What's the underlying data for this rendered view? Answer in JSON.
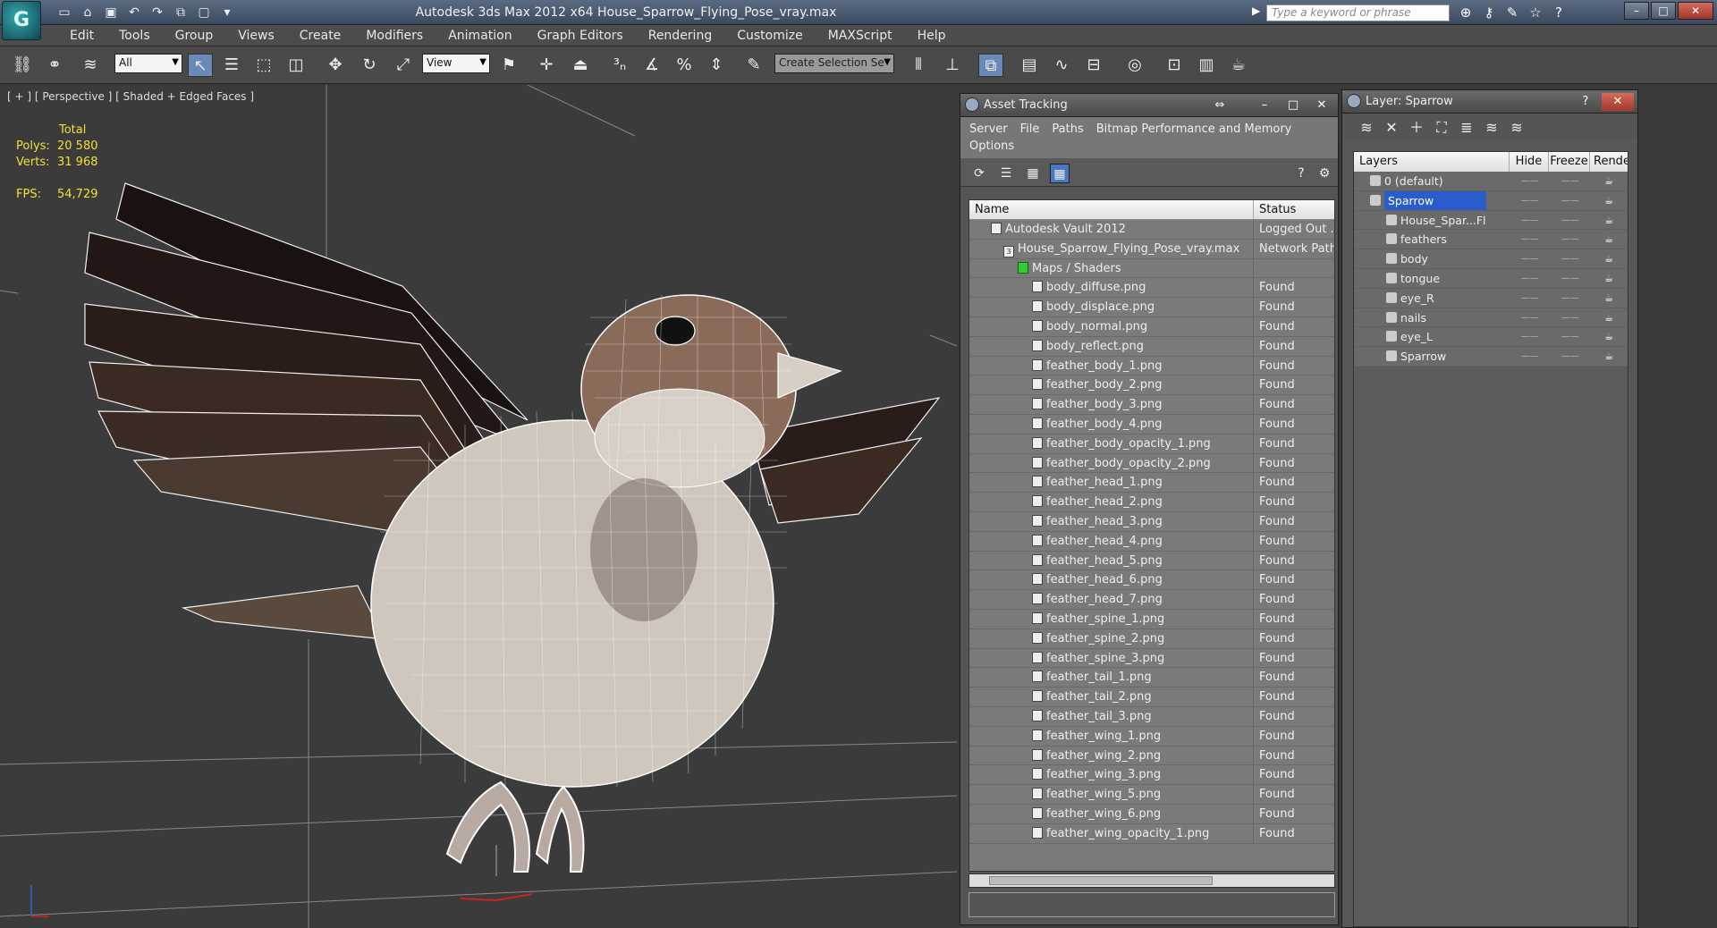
{
  "app": {
    "logo": "G",
    "title": "Autodesk 3ds Max  2012 x64       House_Sparrow_Flying_Pose_vray.max",
    "search_placeholder": "Type a keyword or phrase"
  },
  "menu": [
    "Edit",
    "Tools",
    "Group",
    "Views",
    "Create",
    "Modifiers",
    "Animation",
    "Graph Editors",
    "Rendering",
    "Customize",
    "MAXScript",
    "Help"
  ],
  "toolbar": {
    "selection_filter": "All",
    "ref_coord": "View",
    "named_selection": "Create Selection Se"
  },
  "viewport": {
    "label": "[ + ] [ Perspective ] [ Shaded + Edged Faces ]",
    "stats_header": "Total",
    "polys_label": "Polys:",
    "polys_value": "20 580",
    "verts_label": "Verts:",
    "verts_value": "31 968",
    "fps_label": "FPS:",
    "fps_value": "54,729"
  },
  "asset_tracking": {
    "title": "Asset Tracking",
    "menu": [
      "Server",
      "File",
      "Paths",
      "Bitmap Performance and Memory",
      "Options"
    ],
    "col_name": "Name",
    "col_status": "Status",
    "rows": [
      {
        "name": "Autodesk Vault 2012",
        "status": "Logged Out ...",
        "indent": 24
      },
      {
        "name": "House_Sparrow_Flying_Pose_vray.max",
        "status": "Network Path",
        "indent": 38
      },
      {
        "name": "Maps / Shaders",
        "status": "",
        "indent": 54
      },
      {
        "name": "body_diffuse.png",
        "status": "Found",
        "indent": 70
      },
      {
        "name": "body_displace.png",
        "status": "Found",
        "indent": 70
      },
      {
        "name": "body_normal.png",
        "status": "Found",
        "indent": 70
      },
      {
        "name": "body_reflect.png",
        "status": "Found",
        "indent": 70
      },
      {
        "name": "feather_body_1.png",
        "status": "Found",
        "indent": 70
      },
      {
        "name": "feather_body_2.png",
        "status": "Found",
        "indent": 70
      },
      {
        "name": "feather_body_3.png",
        "status": "Found",
        "indent": 70
      },
      {
        "name": "feather_body_4.png",
        "status": "Found",
        "indent": 70
      },
      {
        "name": "feather_body_opacity_1.png",
        "status": "Found",
        "indent": 70
      },
      {
        "name": "feather_body_opacity_2.png",
        "status": "Found",
        "indent": 70
      },
      {
        "name": "feather_head_1.png",
        "status": "Found",
        "indent": 70
      },
      {
        "name": "feather_head_2.png",
        "status": "Found",
        "indent": 70
      },
      {
        "name": "feather_head_3.png",
        "status": "Found",
        "indent": 70
      },
      {
        "name": "feather_head_4.png",
        "status": "Found",
        "indent": 70
      },
      {
        "name": "feather_head_5.png",
        "status": "Found",
        "indent": 70
      },
      {
        "name": "feather_head_6.png",
        "status": "Found",
        "indent": 70
      },
      {
        "name": "feather_head_7.png",
        "status": "Found",
        "indent": 70
      },
      {
        "name": "feather_spine_1.png",
        "status": "Found",
        "indent": 70
      },
      {
        "name": "feather_spine_2.png",
        "status": "Found",
        "indent": 70
      },
      {
        "name": "feather_spine_3.png",
        "status": "Found",
        "indent": 70
      },
      {
        "name": "feather_tail_1.png",
        "status": "Found",
        "indent": 70
      },
      {
        "name": "feather_tail_2.png",
        "status": "Found",
        "indent": 70
      },
      {
        "name": "feather_tail_3.png",
        "status": "Found",
        "indent": 70
      },
      {
        "name": "feather_wing_1.png",
        "status": "Found",
        "indent": 70
      },
      {
        "name": "feather_wing_2.png",
        "status": "Found",
        "indent": 70
      },
      {
        "name": "feather_wing_3.png",
        "status": "Found",
        "indent": 70
      },
      {
        "name": "feather_wing_5.png",
        "status": "Found",
        "indent": 70
      },
      {
        "name": "feather_wing_6.png",
        "status": "Found",
        "indent": 70
      },
      {
        "name": "feather_wing_opacity_1.png",
        "status": "Found",
        "indent": 70
      }
    ]
  },
  "layer_panel": {
    "title": "Layer: Sparrow",
    "col_layers": "Layers",
    "col_hide": "Hide",
    "col_freeze": "Freeze",
    "col_render": "Rende",
    "rows": [
      {
        "name": "0 (default)",
        "indent": 18,
        "selected": false
      },
      {
        "name": "Sparrow",
        "indent": 18,
        "selected": true
      },
      {
        "name": "House_Spar...Fl",
        "indent": 36,
        "selected": false
      },
      {
        "name": "feathers",
        "indent": 36,
        "selected": false
      },
      {
        "name": "body",
        "indent": 36,
        "selected": false
      },
      {
        "name": "tongue",
        "indent": 36,
        "selected": false
      },
      {
        "name": "eye_R",
        "indent": 36,
        "selected": false
      },
      {
        "name": "nails",
        "indent": 36,
        "selected": false
      },
      {
        "name": "eye_L",
        "indent": 36,
        "selected": false
      },
      {
        "name": "Sparrow",
        "indent": 36,
        "selected": false
      }
    ]
  }
}
